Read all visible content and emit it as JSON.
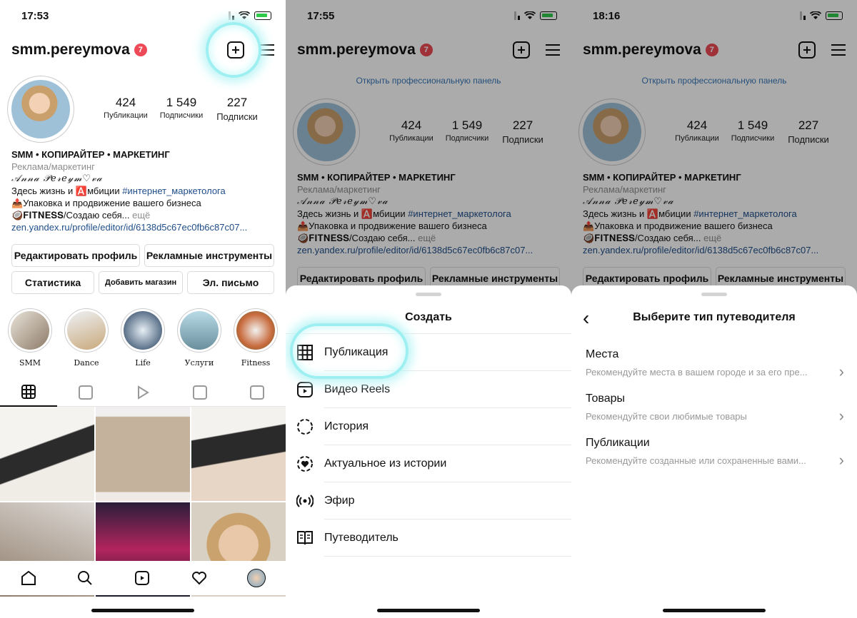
{
  "screens": [
    {
      "time": "17:53",
      "username": "smm.pereymova",
      "notif_count": "7",
      "stats": [
        {
          "num": "424",
          "label": "Публикации"
        },
        {
          "num": "1 549",
          "label": "Подписчики"
        },
        {
          "num": "227",
          "label": "Подписки"
        }
      ],
      "bio": {
        "title": "SMM • КОПИРАЙТЕР • МАРКЕТИНГ",
        "category": "Реклама/маркетинг",
        "name_script": "𝒜𝓃𝓃𝒶 𝒫𝑒𝓇𝑒𝓎𝓂♡𝓋𝒶",
        "line1_a": "Здесь жизнь и ",
        "line1_b": "🅰️мбиции ",
        "line1_hash": "#интернет_маркетолога",
        "line2": "📤Упаковка и продвижение вашего бизнеса",
        "line3_a": "🥥𝐅𝐈𝐓𝐍𝐄𝐒𝐒/Создаю себя...",
        "line3_more": " ещё",
        "link": "zen.yandex.ru/profile/editor/id/6138d5c67ec0fb6c87c07..."
      },
      "buttons": {
        "edit": "Редактировать профиль",
        "ads": "Рекламные инструменты",
        "stats": "Статистика",
        "shop": "Добавить магазин",
        "email": "Эл. письмо"
      },
      "highlights": [
        "SMM",
        "Dance",
        "Life",
        "Услуги",
        "Fitness"
      ]
    },
    {
      "time": "17:55",
      "username": "smm.pereymova",
      "notif_count": "7",
      "pro_link": "Открыть профессиональную панель",
      "stats": [
        {
          "num": "424",
          "label": "Публикации"
        },
        {
          "num": "1 549",
          "label": "Подписчики"
        },
        {
          "num": "227",
          "label": "Подписки"
        }
      ],
      "sheet_title": "Создать",
      "menu": [
        "Публикация",
        "Видео Reels",
        "История",
        "Актуальное из истории",
        "Эфир",
        "Путеводитель"
      ]
    },
    {
      "time": "18:16",
      "username": "smm.pereymova",
      "notif_count": "7",
      "pro_link": "Открыть профессиональную панель",
      "stats": [
        {
          "num": "424",
          "label": "Публикации"
        },
        {
          "num": "1 549",
          "label": "Подписчики"
        },
        {
          "num": "227",
          "label": "Подписки"
        }
      ],
      "sheet_title": "Выберите тип путеводителя",
      "guide_items": [
        {
          "title": "Места",
          "sub": "Рекомендуйте места в вашем городе и за его пре..."
        },
        {
          "title": "Товары",
          "sub": "Рекомендуйте свои любимые товары"
        },
        {
          "title": "Публикации",
          "sub": "Рекомендуйте созданные или сохраненные вами..."
        }
      ]
    }
  ],
  "icons": {
    "new_post": "plus-square-icon",
    "menu": "hamburger-icon",
    "back": "chevron-left-icon",
    "chevron": "chevron-right-icon"
  },
  "colors": {
    "accent_link": "#3978b8",
    "hashtag": "#1f4e8a",
    "badge": "#ed4956",
    "glow": "#9eeff2"
  }
}
